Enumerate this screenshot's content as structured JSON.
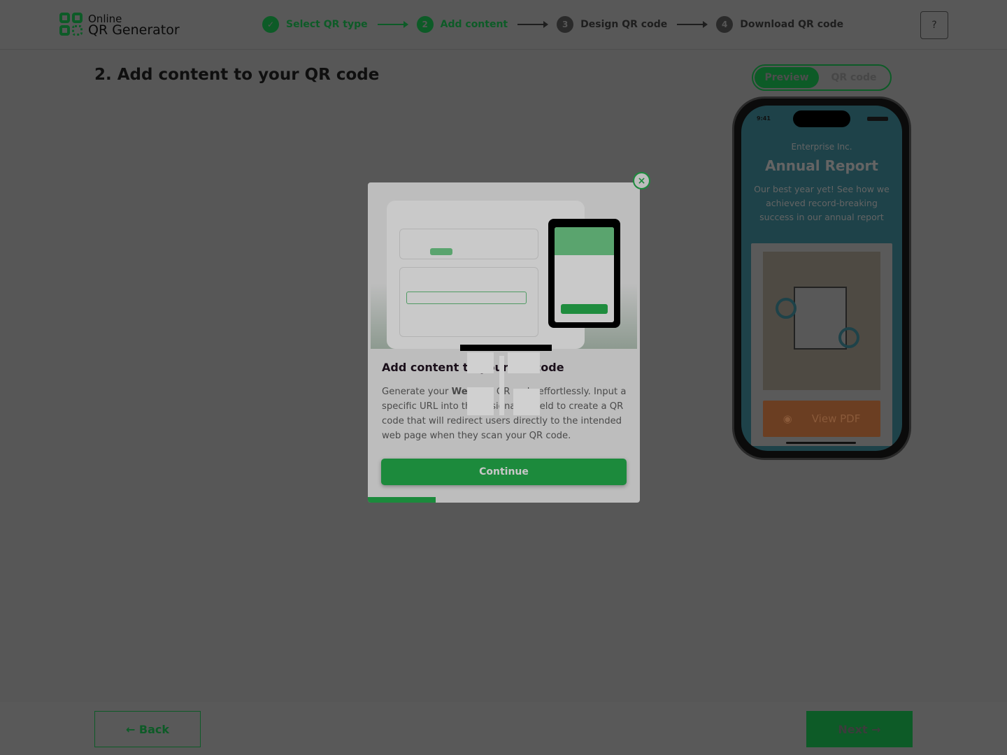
{
  "header": {
    "logo_line1": "Online",
    "logo_line2": "QR Generator",
    "steps": [
      {
        "num": "✓",
        "label": "Select QR type"
      },
      {
        "num": "2",
        "label": "Add content"
      },
      {
        "num": "3",
        "label": "Design QR code"
      },
      {
        "num": "4",
        "label": "Download QR code"
      }
    ],
    "help_icon": "?"
  },
  "page": {
    "title": "2. Add content to your QR code"
  },
  "preview": {
    "toggle": [
      "Preview",
      "QR code"
    ],
    "phone": {
      "time": "9:41",
      "company": "Enterprise Inc.",
      "heading": "Annual Report",
      "description": "Our best year yet! See how we achieved record-breaking success in our annual report",
      "button": "View PDF"
    }
  },
  "modal": {
    "close": "×",
    "title": "Add content to your QR code",
    "text_before": "Generate your ",
    "text_bold": "Website",
    "text_after": " QR code effortlessly. Input a specific URL into the designated field to create a QR code that will redirect users directly to the intended web page when they scan your QR code.",
    "continue": "Continue",
    "progress_percent": 25
  },
  "footer": {
    "back": "Back",
    "next": "Next"
  },
  "colors": {
    "accent": "#1c8a3c",
    "accent_dim": "#0d5b27"
  }
}
